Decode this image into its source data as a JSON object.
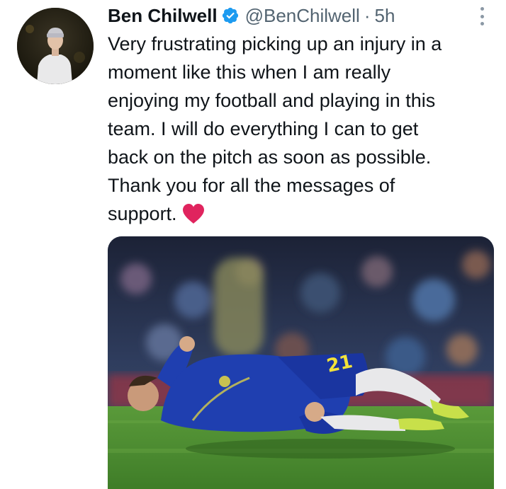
{
  "author": {
    "display_name": "Ben Chilwell",
    "handle": "@BenChilwell",
    "separator": "·",
    "time": "5h",
    "verified": true
  },
  "tweet": {
    "lines": [
      "Very frustrating picking up an injury in a",
      "moment like this when I am really",
      "enjoying my football and playing in this",
      "team. I will do everything I can to get",
      "back on the pitch as soon as possible.",
      "Thank you for all the messages of",
      "support."
    ]
  },
  "media": {
    "jersey_number": "21"
  },
  "icons": {
    "verified": "verified-badge-icon",
    "more": "more-options-icon",
    "heart": "red-heart-icon"
  },
  "colors": {
    "verified_blue": "#1d9bf0",
    "secondary_text": "#536471",
    "heart_red": "#e0245e",
    "kit_blue": "#1f3fb0"
  }
}
